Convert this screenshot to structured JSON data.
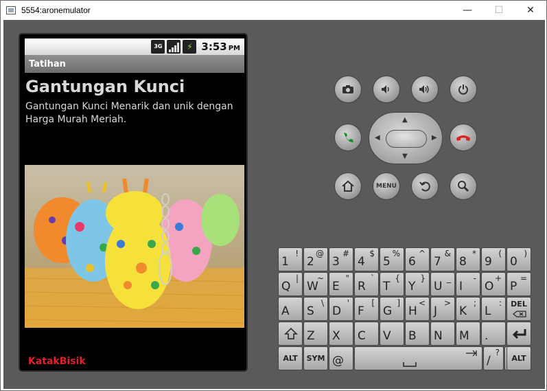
{
  "window": {
    "title": "5554:aronemulator",
    "minimize_label": "—",
    "maximize_label": "☐",
    "close_label": "✕"
  },
  "statusbar": {
    "network": "3G",
    "time": "3:53",
    "ampm": "PM"
  },
  "app": {
    "title": "Tatihan",
    "heading": "Gantungan Kunci",
    "description": "Gantungan Kunci Menarik dan unik dengan Harga Murah Meriah.",
    "footer": "KatakBisik"
  },
  "controls": {
    "menu_label": "MENU"
  },
  "keyboard": {
    "row1": [
      {
        "main": "1",
        "alt": "!"
      },
      {
        "main": "2",
        "alt": "@"
      },
      {
        "main": "3",
        "alt": "#"
      },
      {
        "main": "4",
        "alt": "$"
      },
      {
        "main": "5",
        "alt": "%"
      },
      {
        "main": "6",
        "alt": "^"
      },
      {
        "main": "7",
        "alt": "&"
      },
      {
        "main": "8",
        "alt": "*"
      },
      {
        "main": "9",
        "alt": "("
      },
      {
        "main": "0",
        "alt": ")"
      }
    ],
    "row2": [
      {
        "main": "Q",
        "alt": "|"
      },
      {
        "main": "W",
        "alt": "~"
      },
      {
        "main": "E",
        "alt": "\""
      },
      {
        "main": "R",
        "alt": "`"
      },
      {
        "main": "T",
        "alt": "{"
      },
      {
        "main": "Y",
        "alt": "}"
      },
      {
        "main": "U",
        "alt": "_"
      },
      {
        "main": "I",
        "alt": "-"
      },
      {
        "main": "O",
        "alt": "+"
      },
      {
        "main": "P",
        "alt": "="
      }
    ],
    "row3": [
      {
        "main": "A",
        "alt": ""
      },
      {
        "main": "S",
        "alt": "\\"
      },
      {
        "main": "D",
        "alt": "'"
      },
      {
        "main": "F",
        "alt": "["
      },
      {
        "main": "G",
        "alt": "]"
      },
      {
        "main": "H",
        "alt": "<"
      },
      {
        "main": "J",
        "alt": ">"
      },
      {
        "main": "K",
        "alt": ";"
      },
      {
        "main": "L",
        "alt": ":"
      }
    ],
    "del_label": "DEL",
    "row4": [
      {
        "main": "Z",
        "alt": ""
      },
      {
        "main": "X",
        "alt": ""
      },
      {
        "main": "C",
        "alt": ""
      },
      {
        "main": "V",
        "alt": ""
      },
      {
        "main": "B",
        "alt": ""
      },
      {
        "main": "N",
        "alt": ""
      },
      {
        "main": "M",
        "alt": ""
      },
      {
        "main": ".",
        "alt": ""
      }
    ],
    "alt_label": "ALT",
    "sym_label": "SYM",
    "at_label": "@",
    "slash_main": "/",
    "slash_alt": "?",
    "comma_label": ","
  }
}
